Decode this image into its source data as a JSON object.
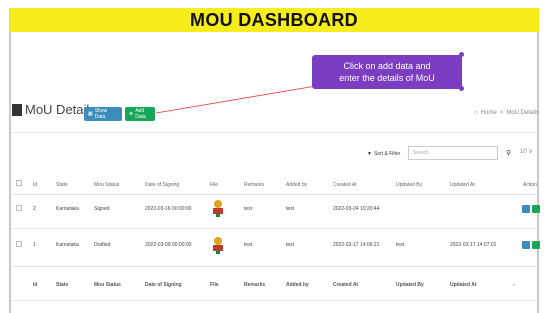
{
  "banner": {
    "title": "MOU DASHBOARD"
  },
  "callout": {
    "line1": "Click on add data and",
    "line2": "enter the details of MoU"
  },
  "page": {
    "title": "MoU Details"
  },
  "buttons": {
    "show_data": "Show Data",
    "add_data": "Add Data"
  },
  "breadcrumb": {
    "home": "Home",
    "sep": ">",
    "current": "MoU Details"
  },
  "toolbar": {
    "sort_filter": "Sort & Filter",
    "search_placeholder": "Search",
    "page_size": "10"
  },
  "table": {
    "headers": [
      "Id",
      "State",
      "Mou Status",
      "Date of Signing",
      "File",
      "Remarks",
      "Added by",
      "Created At",
      "Updated By",
      "Updated At",
      "Action"
    ],
    "rows": [
      {
        "id": "2",
        "state": "Karnataka",
        "status": "Signed",
        "date": "2022-03-16 00:00:00",
        "remarks": "test",
        "added_by": "test",
        "created_at": "2022-03-24 10:20:44",
        "updated_by": "",
        "updated_at": ""
      },
      {
        "id": "1",
        "state": "Karnataka",
        "status": "Drafted",
        "date": "2022-03-09 00:00:00",
        "remarks": "test",
        "added_by": "test",
        "created_at": "2022-03-17 14:06:21",
        "updated_by": "test",
        "updated_at": "2022-03-17 14:07:01"
      }
    ],
    "footer": [
      "Id",
      "State",
      "Mou Status",
      "Date of Signing",
      "File",
      "Remarks",
      "Added by",
      "Created At",
      "Updated By",
      "Updated At",
      "-"
    ]
  },
  "colors": {
    "banner": "#f7ec1c",
    "callout": "#7b3dc1",
    "primary": "#3c8dbc",
    "success": "#18a55a"
  },
  "icons": {
    "folder": "folder-icon",
    "sort": "sort-icon",
    "search": "search-icon",
    "view": "eye-icon",
    "edit": "pencil-icon",
    "file": "emblem-icon"
  }
}
